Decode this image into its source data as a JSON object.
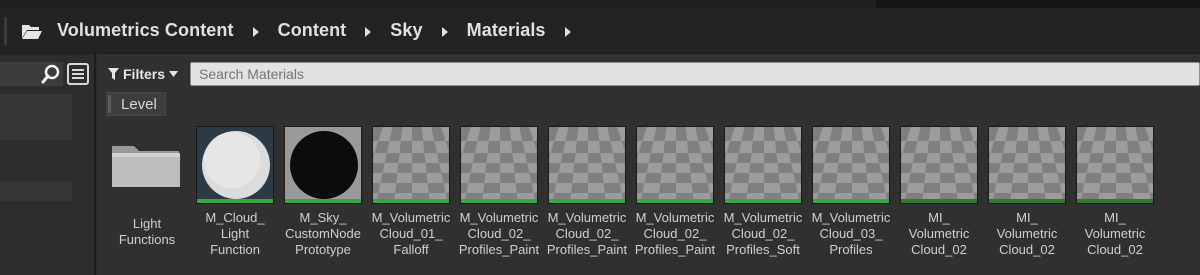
{
  "breadcrumb": [
    "Volumetrics Content",
    "Content",
    "Sky",
    "Materials"
  ],
  "toolbar": {
    "filters_label": "Filters"
  },
  "search": {
    "placeholder": "Search Materials"
  },
  "level_chip": "Level",
  "assets": [
    {
      "label": "Light\nFunctions",
      "kind": "folder"
    },
    {
      "label": "M_Cloud_\nLight\nFunction",
      "kind": "material-white-sphere"
    },
    {
      "label": "M_Sky_\nCustomNode\nPrototype",
      "kind": "material-black-sphere"
    },
    {
      "label": "M_Volumetric\nCloud_01_\nFalloff",
      "kind": "material-checker"
    },
    {
      "label": "M_Volumetric\nCloud_02_\nProfiles_Paint",
      "kind": "material-checker"
    },
    {
      "label": "M_Volumetric\nCloud_02_\nProfiles_Paint",
      "kind": "material-checker"
    },
    {
      "label": "M_Volumetric\nCloud_02_\nProfiles_Paint",
      "kind": "material-checker"
    },
    {
      "label": "M_Volumetric\nCloud_02_\nProfiles_Soft",
      "kind": "material-checker"
    },
    {
      "label": "M_Volumetric\nCloud_03_\nProfiles",
      "kind": "material-checker"
    },
    {
      "label": "MI_\nVolumetric\nCloud_02",
      "kind": "material-instance-checker"
    },
    {
      "label": "MI_\nVolumetric\nCloud_02",
      "kind": "material-instance-checker"
    },
    {
      "label": "MI_\nVolumetric\nCloud_02",
      "kind": "material-instance-checker"
    }
  ],
  "colors": {
    "material_stripe": "#37a83e",
    "instance_stripe": "#2a7a2f"
  }
}
